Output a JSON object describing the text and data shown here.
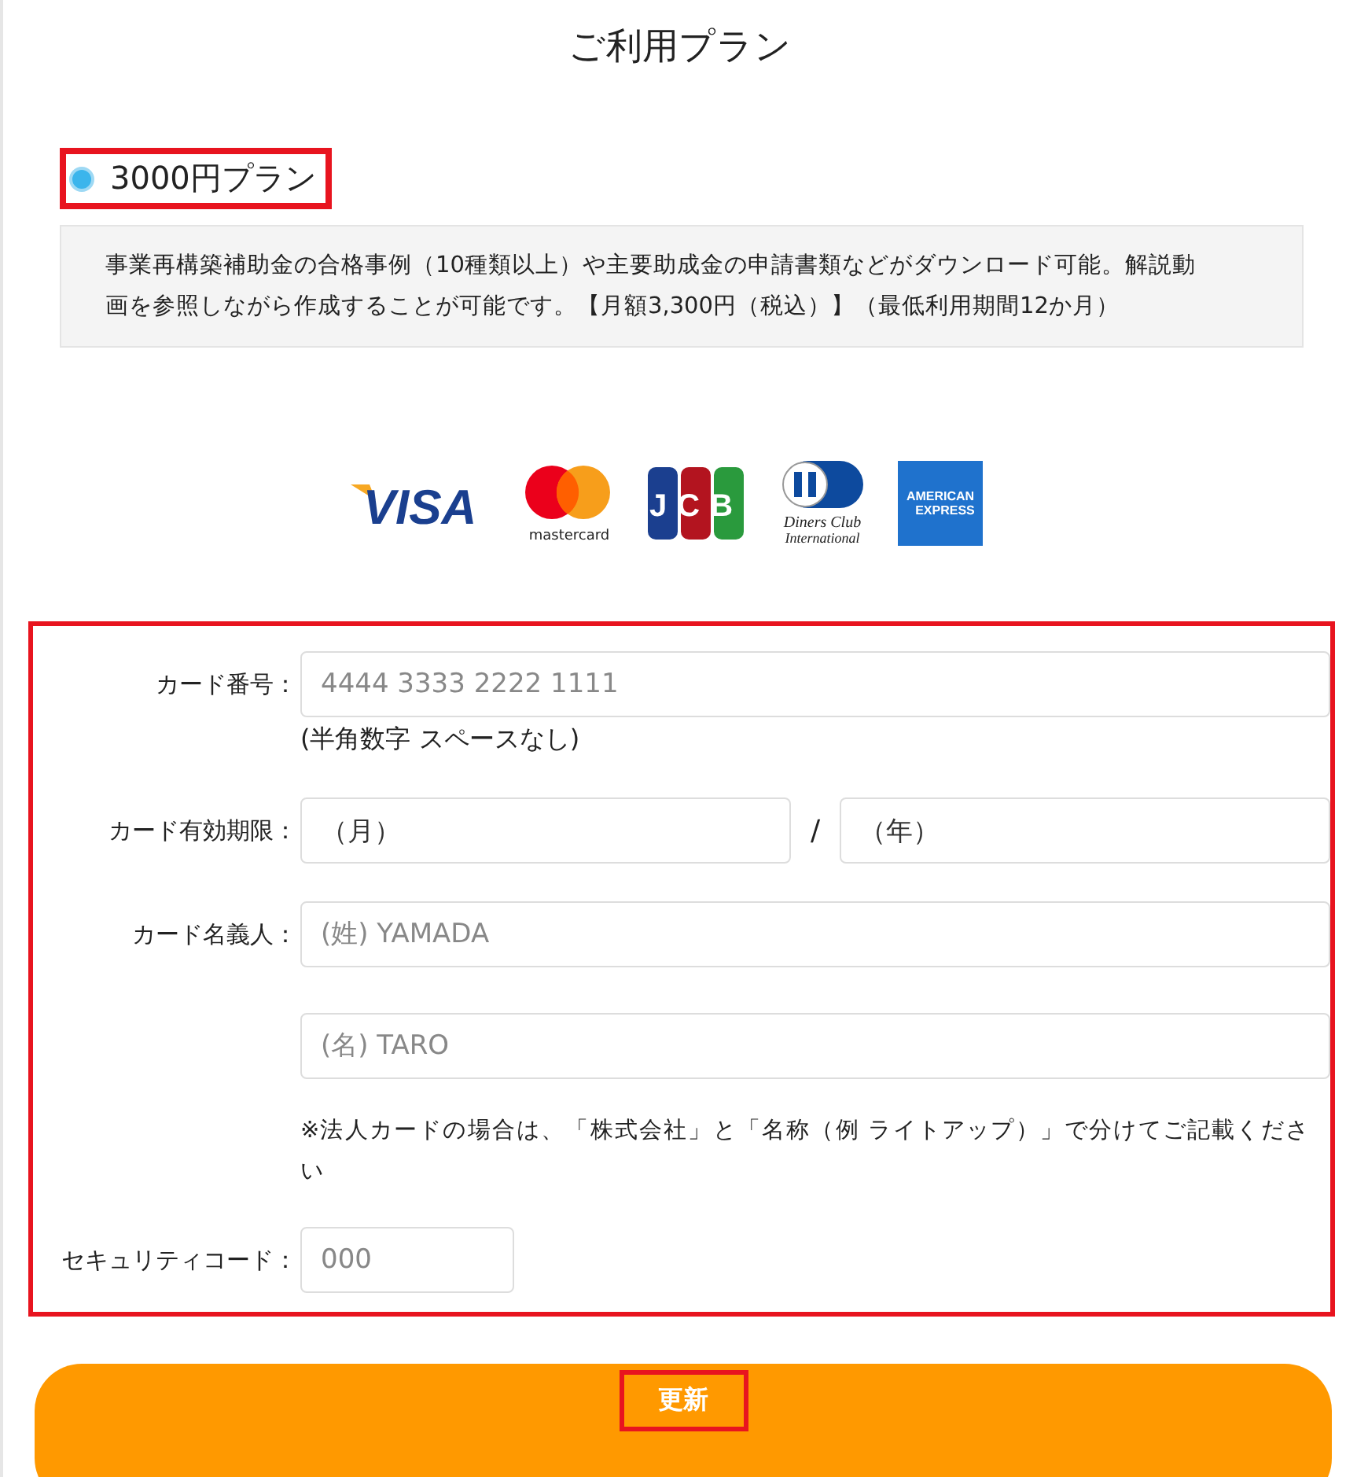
{
  "page_title": "ご利用プラン",
  "plan": {
    "label": "3000円プラン",
    "selected": true,
    "highlighted": true,
    "description": "事業再構築補助金の合格事例（10種類以上）や主要助成金の申請書類などがダウンロード可能。解説動画を参照しながら作成することが可能です。【月額3,300円（税込）】（最低利用期間12か月）"
  },
  "card_brands": [
    {
      "kind": "visa",
      "lines": [
        "VISA"
      ]
    },
    {
      "kind": "mastercard",
      "lines": [
        "mastercard"
      ]
    },
    {
      "kind": "jcb",
      "lines": [
        "JCB"
      ]
    },
    {
      "kind": "diners",
      "lines": [
        "Diners Club",
        "International"
      ]
    },
    {
      "kind": "amex",
      "lines": [
        "AMERICAN",
        "EXPRESS"
      ]
    }
  ],
  "form": {
    "highlighted": true,
    "card_number": {
      "label": "カード番号：",
      "placeholder": "4444 3333 2222 1111",
      "hint": "(半角数字 スペースなし)"
    },
    "expiry": {
      "label": "カード有効期限：",
      "month": "（月）",
      "separator": "/",
      "year": "（年）"
    },
    "holder": {
      "label": "カード名義人：",
      "last_placeholder": "(姓) YAMADA",
      "first_placeholder": "(名) TARO",
      "note": "※法人カードの場合は、「株式会社」と「名称（例 ライトアップ）」で分けてご記載ください"
    },
    "security": {
      "label": "セキュリティコード：",
      "placeholder": "000"
    }
  },
  "submit": {
    "label": "更新",
    "highlighted": true
  }
}
